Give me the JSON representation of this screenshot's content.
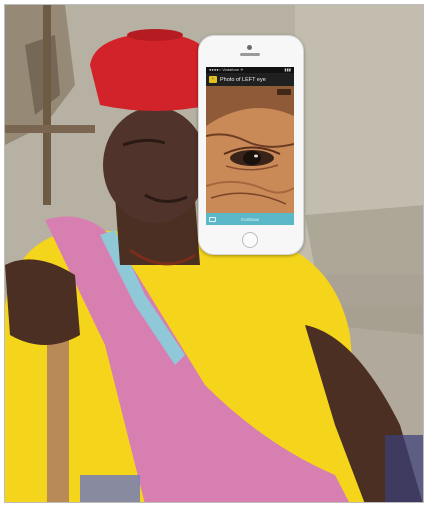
{
  "phone": {
    "status_left": "●●●●○ Vodafone ✈",
    "status_right": "▮▮▮",
    "nav_title": "Photo of LEFT eye",
    "back_icon": "back-arrow-icon",
    "action_label": "Continue",
    "action_icon": "keyboard-icon"
  },
  "colors": {
    "hat": "#d3232a",
    "shirt": "#f4d51c",
    "scarf": "#d77fb0",
    "phone_body": "#f7f7f7",
    "action_bar": "#5bb8c8"
  }
}
